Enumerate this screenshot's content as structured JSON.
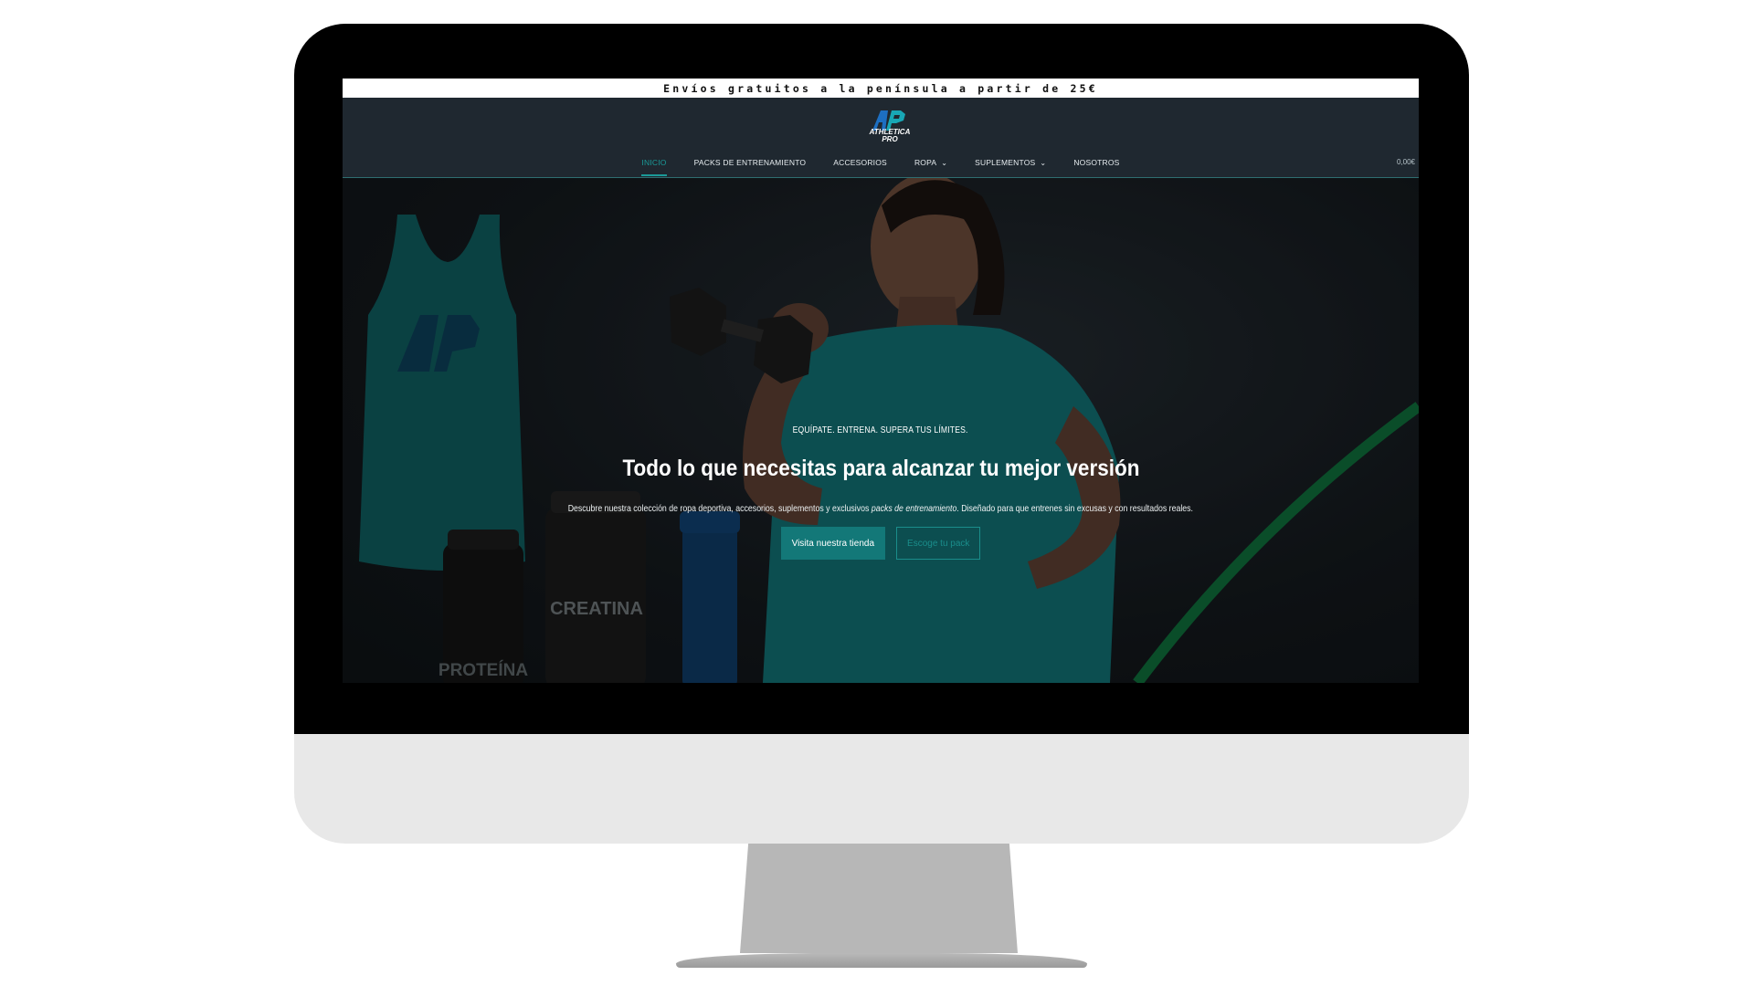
{
  "announcement": {
    "text": "Envíos gratuitos a la península a partir de 25€"
  },
  "brand": {
    "line1": "ATHLETICA",
    "line2": "PRO",
    "accent_color": "#137878"
  },
  "nav": {
    "items": [
      {
        "label": "INICIO",
        "active": true
      },
      {
        "label": "PACKS DE ENTRENAMIENTO"
      },
      {
        "label": "ACCESORIOS"
      },
      {
        "label": "ROPA",
        "dropdown": true
      },
      {
        "label": "SUPLEMENTOS",
        "dropdown": true
      },
      {
        "label": "NOSOTROS"
      }
    ],
    "cart_total": "0,00€"
  },
  "hero": {
    "eyebrow": "EQUÍPATE. ENTRENA. SUPERA TUS LÍMITES.",
    "headline": "Todo lo que necesitas para alcanzar tu mejor versión",
    "description_before": "Descubre nuestra colección de ropa deportiva, accesorios, suplementos y exclusivos ",
    "description_emphasis": "packs de entrenamiento",
    "description_after": ". Diseñado para que entrenes sin excusas y con resultados reales.",
    "primary_button": "Visita nuestra tienda",
    "secondary_button": "Escoge tu pack",
    "product_labels": {
      "creatina": "CREATINA",
      "proteina": "PROTEÍNA"
    }
  }
}
